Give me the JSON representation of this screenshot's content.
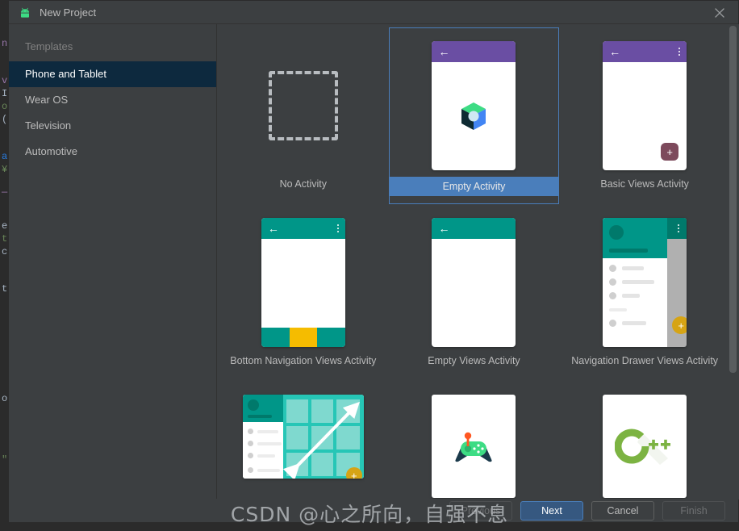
{
  "window": {
    "title": "New Project",
    "icon": "android-icon",
    "close_label": "×"
  },
  "sidebar": {
    "header": "Templates",
    "items": [
      {
        "label": "Phone and Tablet",
        "selected": true
      },
      {
        "label": "Wear OS",
        "selected": false
      },
      {
        "label": "Television",
        "selected": false
      },
      {
        "label": "Automotive",
        "selected": false
      }
    ]
  },
  "templates": [
    {
      "label": "No Activity",
      "thumb": "dashed-box",
      "selected": false
    },
    {
      "label": "Empty Activity",
      "thumb": "compose-phone",
      "selected": true
    },
    {
      "label": "Basic Views Activity",
      "thumb": "basic-views-phone",
      "selected": false
    },
    {
      "label": "Bottom Navigation Views Activity",
      "thumb": "bottom-nav-phone",
      "selected": false
    },
    {
      "label": "Empty Views Activity",
      "thumb": "empty-views-phone",
      "selected": false
    },
    {
      "label": "Navigation Drawer Views Activity",
      "thumb": "nav-drawer-phone",
      "selected": false
    },
    {
      "label": "",
      "thumb": "responsive-tablet",
      "selected": false
    },
    {
      "label": "",
      "thumb": "game-controller",
      "selected": false
    },
    {
      "label": "",
      "thumb": "cpp-logo",
      "selected": false
    }
  ],
  "footer": {
    "previous": "Previous",
    "next": "Next",
    "cancel": "Cancel",
    "finish": "Finish"
  },
  "watermark": "CSDN @心之所向，自强不息",
  "colors": {
    "selection_blue": "#4a7ebb",
    "sidebar_selected": "#0d293e",
    "primary_button": "#365880",
    "toolbar_purple": "#6a4ea3",
    "toolbar_teal": "#009688",
    "accent_yellow": "#f5bc00",
    "cpp_green": "#7cb342",
    "panel_bg": "#3c3f41"
  },
  "background_code": [
    "n",
    "",
    "",
    "v",
    "I",
    "o",
    "(",
    "",
    "aM",
    "¥",
    "—",
    "",
    "e",
    "t:",
    "c",
    "",
    "t",
    "",
    "",
    "",
    "o",
    "",
    "\""
  ]
}
